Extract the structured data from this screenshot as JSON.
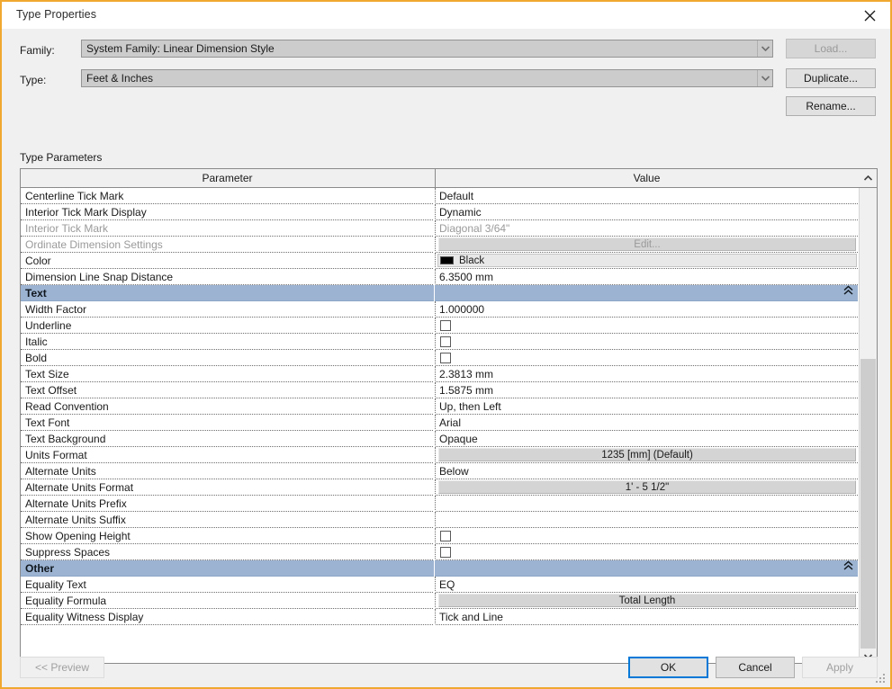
{
  "window": {
    "title": "Type Properties",
    "close_icon": "close-icon",
    "border_color": "#f0a830"
  },
  "form": {
    "family_label": "Family:",
    "family_value": "System Family: Linear Dimension Style",
    "type_label": "Type:",
    "type_value": "Feet & Inches",
    "dropdown_icon": "chevron-down-icon"
  },
  "side_buttons": [
    {
      "label": "Load...",
      "name": "load-button",
      "disabled": true
    },
    {
      "label": "Duplicate...",
      "name": "duplicate-button",
      "disabled": false
    },
    {
      "label": "Rename...",
      "name": "rename-button",
      "disabled": false
    }
  ],
  "grid": {
    "caption": "Type Parameters",
    "columns": [
      "Parameter",
      "Value"
    ],
    "collapse_icon": "chevrons-up-icon",
    "scrollbar": {
      "up_icon": "chevron-up-icon",
      "down_icon": "chevron-down-icon"
    },
    "rows": [
      {
        "kind": "param",
        "name": "Centerline Tick Mark",
        "value_type": "text",
        "value": "Default",
        "dim": false
      },
      {
        "kind": "param",
        "name": "Interior Tick Mark Display",
        "value_type": "text",
        "value": "Dynamic",
        "dim": false
      },
      {
        "kind": "param",
        "name": "Interior Tick Mark",
        "value_type": "text",
        "value": "Diagonal 3/64\"",
        "dim": true
      },
      {
        "kind": "param",
        "name": "Ordinate Dimension Settings",
        "value_type": "button",
        "value": "Edit...",
        "dim": true
      },
      {
        "kind": "param",
        "name": "Color",
        "value_type": "color",
        "value": "Black",
        "swatch": "#000000",
        "dim": false
      },
      {
        "kind": "param",
        "name": "Dimension Line Snap Distance",
        "value_type": "text",
        "value": "6.3500 mm",
        "dim": false
      },
      {
        "kind": "group",
        "name": "Text"
      },
      {
        "kind": "param",
        "name": "Width Factor",
        "value_type": "text",
        "value": "1.000000",
        "dim": false
      },
      {
        "kind": "param",
        "name": "Underline",
        "value_type": "checkbox",
        "checked": false,
        "dim": false
      },
      {
        "kind": "param",
        "name": "Italic",
        "value_type": "checkbox",
        "checked": false,
        "dim": false
      },
      {
        "kind": "param",
        "name": "Bold",
        "value_type": "checkbox",
        "checked": false,
        "dim": false
      },
      {
        "kind": "param",
        "name": "Text Size",
        "value_type": "text",
        "value": "2.3813 mm",
        "dim": false
      },
      {
        "kind": "param",
        "name": "Text Offset",
        "value_type": "text",
        "value": "1.5875 mm",
        "dim": false
      },
      {
        "kind": "param",
        "name": "Read Convention",
        "value_type": "text",
        "value": "Up, then Left",
        "dim": false
      },
      {
        "kind": "param",
        "name": "Text Font",
        "value_type": "text",
        "value": "Arial",
        "dim": false
      },
      {
        "kind": "param",
        "name": "Text Background",
        "value_type": "text",
        "value": "Opaque",
        "dim": false
      },
      {
        "kind": "param",
        "name": "Units Format",
        "value_type": "button",
        "value": "1235 [mm] (Default)",
        "dim": false
      },
      {
        "kind": "param",
        "name": "Alternate Units",
        "value_type": "text",
        "value": "Below",
        "dim": false
      },
      {
        "kind": "param",
        "name": "Alternate Units Format",
        "value_type": "button",
        "value": "1' - 5 1/2\"",
        "dim": false
      },
      {
        "kind": "param",
        "name": "Alternate Units Prefix",
        "value_type": "text",
        "value": "",
        "dim": false
      },
      {
        "kind": "param",
        "name": "Alternate Units Suffix",
        "value_type": "text",
        "value": "",
        "dim": false
      },
      {
        "kind": "param",
        "name": "Show Opening Height",
        "value_type": "checkbox",
        "checked": false,
        "dim": false
      },
      {
        "kind": "param",
        "name": "Suppress Spaces",
        "value_type": "checkbox",
        "checked": false,
        "dim": false
      },
      {
        "kind": "group",
        "name": "Other"
      },
      {
        "kind": "param",
        "name": "Equality Text",
        "value_type": "text",
        "value": "EQ",
        "dim": false
      },
      {
        "kind": "param",
        "name": "Equality Formula",
        "value_type": "button",
        "value": "Total Length",
        "dim": false
      },
      {
        "kind": "param",
        "name": "Equality Witness Display",
        "value_type": "text",
        "value": "Tick and Line",
        "dim": false
      }
    ]
  },
  "footer": {
    "preview_label": "<< Preview",
    "ok_label": "OK",
    "cancel_label": "Cancel",
    "apply_label": "Apply",
    "focus_color": "#0078d7"
  }
}
